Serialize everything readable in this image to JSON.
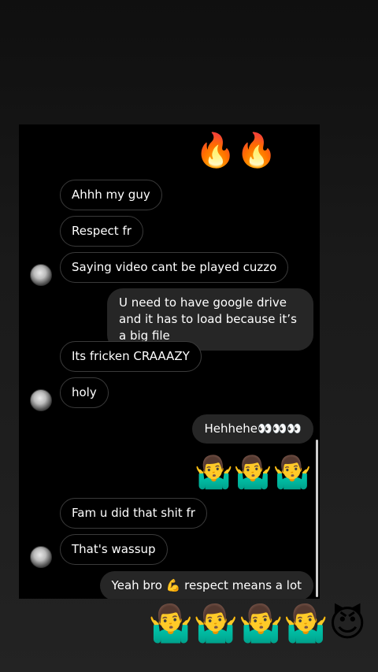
{
  "messages": {
    "m0": "🔥🔥😈",
    "m1": "Ahhh my guy",
    "m2": "Respect  fr",
    "m3": "Saying video cant be played cuzzo",
    "m4": "U need to have google drive and it has to load because it’s a big file",
    "m5": "Its fricken CRAAAZY",
    "m6": "holy",
    "m7": "Hehhehe👀👀👀",
    "m8": "🤷‍♂️🤷‍♂️🤷‍♂️",
    "m9": "Fam u did that shit fr",
    "m10": "That's wassup",
    "m11": "Yeah bro 💪 respect means a lot"
  },
  "overlay": {
    "emoji": "🤷‍♂️🤷‍♂️🤷‍♂️🤷‍♂️😈"
  },
  "icons": {
    "avatar": "profile-avatar-icon"
  },
  "colors": {
    "incoming_border": "#3a3a3a",
    "outgoing_bg": "#262626",
    "chat_bg": "#000000",
    "page_bg": "#1a1a1a"
  }
}
